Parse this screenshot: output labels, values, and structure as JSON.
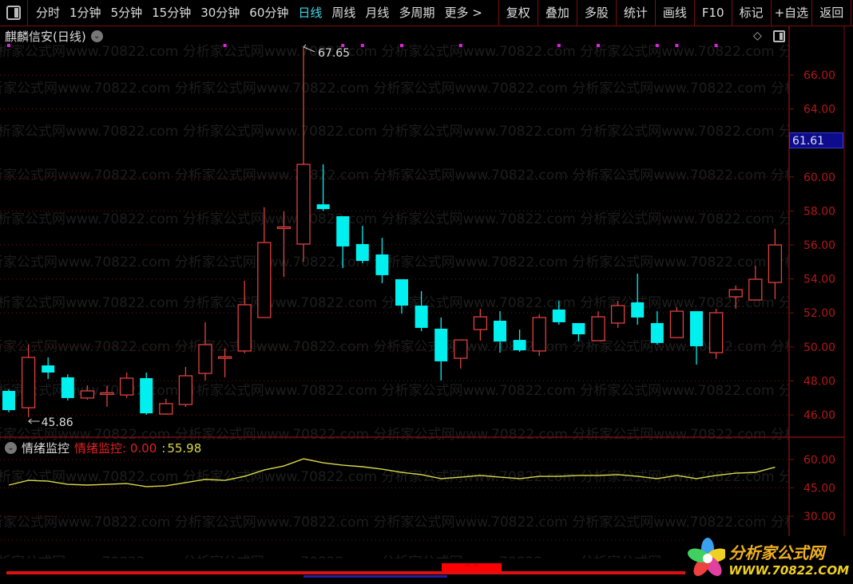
{
  "toolbar": {
    "periods": [
      "分时",
      "1分钟",
      "5分钟",
      "15分钟",
      "30分钟",
      "60分钟",
      "日线",
      "周线",
      "月线",
      "多周期",
      "更多 >"
    ],
    "active_period": "日线",
    "actions": [
      "复权",
      "叠加",
      "多股",
      "统计",
      "画线",
      "F10",
      "标记",
      "+自选",
      "返回"
    ]
  },
  "chart": {
    "title": "麒麟信安(日线)",
    "current_price_label": "61.61",
    "high_label": "67.65",
    "low_label": "45.86"
  },
  "indicator": {
    "panel_name": "情绪监控",
    "series_name": "情绪监控",
    "value_a": "0.00",
    "value_b": "55.98"
  },
  "watermark": "分析家公式网www.70822.com",
  "logo": {
    "name": "分析家公式网",
    "url": "WWW.70822.COM"
  },
  "colors": {
    "up": "#e04040",
    "down": "#00f0f0",
    "indicator_line": "#d8d84a",
    "grid": "#7a0d0d",
    "axis_text": "#b01818",
    "signal": "#e020e0"
  },
  "chart_data": {
    "type": "candlestick",
    "price_axis": {
      "min": 45,
      "max": 67,
      "ticks": [
        46,
        48,
        50,
        52,
        54,
        56,
        58,
        60,
        62,
        64,
        66
      ],
      "tick_labels": [
        "46.00",
        "48.00",
        "50.00",
        "52.00",
        "54.00",
        "56.00",
        "58.00",
        "60.00",
        "62.00",
        "64.00",
        "66.00"
      ]
    },
    "candles": [
      [
        47.41,
        47.5,
        46.15,
        46.28
      ],
      [
        46.42,
        50.13,
        45.86,
        49.38
      ],
      [
        48.91,
        49.38,
        48.11,
        48.49
      ],
      [
        48.21,
        48.39,
        46.85,
        46.99
      ],
      [
        46.99,
        47.74,
        46.89,
        47.41
      ],
      [
        47.23,
        47.69,
        46.47,
        47.3
      ],
      [
        47.17,
        48.49,
        47.0,
        48.16
      ],
      [
        48.16,
        48.49,
        46.0,
        46.09
      ],
      [
        46.05,
        46.94,
        46.0,
        46.66
      ],
      [
        46.61,
        48.82,
        46.47,
        48.3
      ],
      [
        48.44,
        51.45,
        48.02,
        50.13
      ],
      [
        49.35,
        49.9,
        48.21,
        49.42
      ],
      [
        49.76,
        53.89,
        49.62,
        52.48
      ],
      [
        51.73,
        58.21,
        51.73,
        56.14
      ],
      [
        57.0,
        57.97,
        54.12,
        57.06
      ],
      [
        56.05,
        67.65,
        55.01,
        60.74
      ],
      [
        58.39,
        60.74,
        58.0,
        58.11
      ],
      [
        57.69,
        57.69,
        54.64,
        55.91
      ],
      [
        56.05,
        57.13,
        54.92,
        55.06
      ],
      [
        55.44,
        56.42,
        53.75,
        54.22
      ],
      [
        53.98,
        53.98,
        51.96,
        52.43
      ],
      [
        52.43,
        53.28,
        50.93,
        51.12
      ],
      [
        51.07,
        51.73,
        48.02,
        49.15
      ],
      [
        49.33,
        50.41,
        48.72,
        50.41
      ],
      [
        51.02,
        52.24,
        50.37,
        51.77
      ],
      [
        51.54,
        52.1,
        49.66,
        50.32
      ],
      [
        50.41,
        51.02,
        49.71,
        49.8
      ],
      [
        49.76,
        51.92,
        49.47,
        51.73
      ],
      [
        52.2,
        52.71,
        51.31,
        51.45
      ],
      [
        51.4,
        51.4,
        50.32,
        50.74
      ],
      [
        50.37,
        52.1,
        50.37,
        51.77
      ],
      [
        51.4,
        52.71,
        51.12,
        52.43
      ],
      [
        52.62,
        54.31,
        51.31,
        51.73
      ],
      [
        51.4,
        52.1,
        50.13,
        50.23
      ],
      [
        50.55,
        52.34,
        50.55,
        52.1
      ],
      [
        52.1,
        52.1,
        48.96,
        50.04
      ],
      [
        49.66,
        52.24,
        49.29,
        52.01
      ],
      [
        52.95,
        53.61,
        52.24,
        53.37
      ],
      [
        52.76,
        54.78,
        52.76,
        53.98
      ],
      [
        53.79,
        56.94,
        52.81,
        56.0
      ]
    ],
    "candle_fields": [
      "open",
      "high",
      "low",
      "close"
    ],
    "signal_marks": [
      0,
      11,
      17,
      18,
      20,
      23,
      28,
      30,
      33,
      34,
      36
    ],
    "indicator": {
      "name": "情绪监控",
      "axis": {
        "min": 22,
        "max": 68,
        "ticks": [
          30,
          45,
          60
        ],
        "tick_labels": [
          "30.00",
          "45.00",
          "60.00"
        ]
      },
      "values": [
        46.5,
        49.0,
        48.6,
        46.9,
        46.5,
        46.9,
        47.3,
        45.7,
        46.1,
        47.8,
        49.5,
        49.0,
        51.1,
        54.5,
        56.6,
        60.4,
        58.3,
        57.0,
        56.2,
        54.9,
        53.2,
        52.0,
        49.9,
        50.7,
        51.6,
        50.7,
        49.9,
        51.1,
        51.1,
        51.6,
        51.6,
        52.0,
        51.1,
        49.9,
        51.6,
        49.9,
        51.6,
        52.8,
        53.2,
        55.98
      ]
    }
  }
}
